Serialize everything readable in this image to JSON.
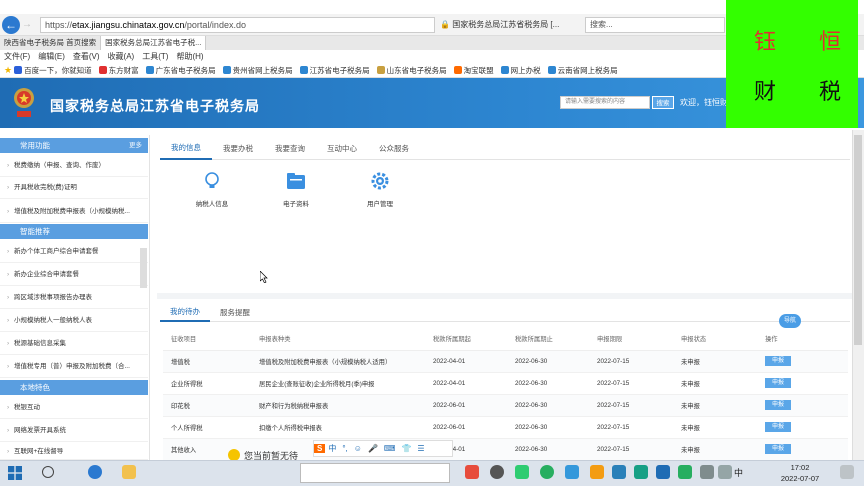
{
  "browser": {
    "url_prefix": "https://",
    "url_domain": "etax.jiangsu.chinatax.gov.cn",
    "url_path": "/portal/index.do",
    "security_title": "国家税务总局江苏省税务局 [...",
    "search_placeholder": "搜索...",
    "tabs": [
      {
        "label": "陕西省电子税务局 首页搜索"
      },
      {
        "label": "国家税务总局江苏省电子税..."
      }
    ],
    "menu": [
      "文件(F)",
      "编辑(E)",
      "查看(V)",
      "收藏(A)",
      "工具(T)",
      "帮助(H)"
    ],
    "favorites": [
      {
        "label": "百度一下，你就知道",
        "color": "#2b5fd9"
      },
      {
        "label": "东方财富",
        "color": "#e03030"
      },
      {
        "label": "广东省电子税务局",
        "color": "#2d86d1"
      },
      {
        "label": "贵州省网上税务局",
        "color": "#2d86d1"
      },
      {
        "label": "江苏省电子税务局",
        "color": "#2d86d1"
      },
      {
        "label": "山东省电子税务局",
        "color": "#c8a040"
      },
      {
        "label": "淘宝联盟",
        "color": "#ff6a00"
      },
      {
        "label": "网上办税",
        "color": "#2d86d1"
      },
      {
        "label": "云南省网上税务局",
        "color": "#2d86d1"
      }
    ]
  },
  "site": {
    "title": "国家税务总局江苏省电子税务局",
    "search_placeholder": "请输入需要搜索的内容",
    "search_label": "搜索",
    "welcome": "欢迎，钰恒财税"
  },
  "watermark": {
    "line1": "钰 恒",
    "line2": "财 税"
  },
  "sidebar": {
    "sections": [
      {
        "title": "常用功能",
        "more": "更多",
        "items": [
          "税费缴纳（申报、查询、作废）",
          "开具税收完税(费)证明",
          "增值税及附加税费申报表（小规模纳税..."
        ]
      },
      {
        "title": "智能推荐",
        "items": [
          "新办个体工商户综合申请套餐",
          "新办企业综合申请套餐",
          "跨区域涉税事项报告办理表",
          "小规模纳税人一般纳税人表",
          "税源基础信息采集",
          "增值税专用（普）申报及附加税费（合..."
        ]
      },
      {
        "title": "本地特色",
        "items": [
          "税银互动",
          "网络发票开具系统",
          "互联网+在线督导"
        ]
      }
    ]
  },
  "main": {
    "tabs": [
      "我的信息",
      "我要办税",
      "我要查询",
      "互动中心",
      "公众服务"
    ],
    "quick": [
      {
        "label": "纳税人信息",
        "icon": "bulb-icon"
      },
      {
        "label": "电子资料",
        "icon": "folder-icon"
      },
      {
        "label": "用户管理",
        "icon": "gear-icon"
      }
    ],
    "todo_tabs": [
      "我的待办",
      "服务提醒"
    ],
    "bubble": "导航",
    "table": {
      "headers": [
        "征收项目",
        "申报表种类",
        "税款所属期起",
        "税款所属期止",
        "申报期限",
        "申报状态",
        "操作"
      ],
      "rows": [
        [
          "增值税",
          "增值税及附加税费申报表（小规模纳税人适用）",
          "2022-04-01",
          "2022-06-30",
          "2022-07-15",
          "未申报",
          "申报"
        ],
        [
          "企业所得税",
          "居民企业(查账征收)企业所得税月(季)申报",
          "2022-04-01",
          "2022-06-30",
          "2022-07-15",
          "未申报",
          "申报"
        ],
        [
          "印花税",
          "财产和行为税纳税申报表",
          "2022-06-01",
          "2022-06-30",
          "2022-07-15",
          "未申报",
          "申报"
        ],
        [
          "个人所得税",
          "扣缴个人所得税申报表",
          "2022-06-01",
          "2022-06-30",
          "2022-07-15",
          "未申报",
          "申报"
        ],
        [
          "其他收入",
          "",
          "2022-04-01",
          "2022-06-30",
          "2022-07-15",
          "未申报",
          "申报"
        ]
      ]
    }
  },
  "ime": {
    "brand": "S",
    "mode": "中"
  },
  "notice": "您当前暂无待",
  "taskbar": {
    "ime": "中",
    "time": "17:02",
    "date": "2022-07-07"
  }
}
